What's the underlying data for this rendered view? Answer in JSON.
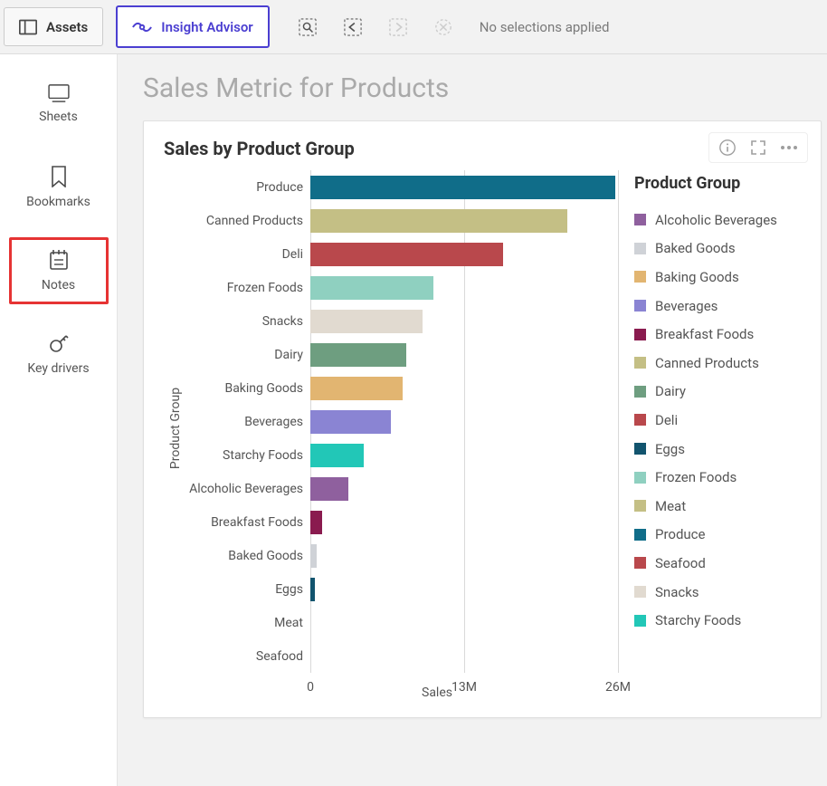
{
  "topbar": {
    "assets_label": "Assets",
    "insight_label": "Insight Advisor",
    "selections_text": "No selections applied"
  },
  "sidebar": {
    "items": [
      {
        "label": "Sheets"
      },
      {
        "label": "Bookmarks"
      },
      {
        "label": "Notes"
      },
      {
        "label": "Key drivers"
      }
    ]
  },
  "page": {
    "title": "Sales Metric for Products"
  },
  "card": {
    "title": "Sales by Product Group"
  },
  "legend": {
    "title": "Product Group",
    "items": [
      {
        "name": "Alcoholic Beverages",
        "color": "#8f609e"
      },
      {
        "name": "Baked Goods",
        "color": "#cfd2d7"
      },
      {
        "name": "Baking Goods",
        "color": "#e2b571"
      },
      {
        "name": "Beverages",
        "color": "#8a84d3"
      },
      {
        "name": "Breakfast Foods",
        "color": "#8a1b4f"
      },
      {
        "name": "Canned Products",
        "color": "#c4bf85"
      },
      {
        "name": "Dairy",
        "color": "#6e9e80"
      },
      {
        "name": "Deli",
        "color": "#b9484c"
      },
      {
        "name": "Eggs",
        "color": "#12546e"
      },
      {
        "name": "Frozen Foods",
        "color": "#8fd0c0"
      },
      {
        "name": "Meat",
        "color": "#c4bf85"
      },
      {
        "name": "Produce",
        "color": "#106d89"
      },
      {
        "name": "Seafood",
        "color": "#b9484c"
      },
      {
        "name": "Snacks",
        "color": "#e1dad0"
      },
      {
        "name": "Starchy Foods",
        "color": "#22c7b7"
      }
    ]
  },
  "chart_data": {
    "type": "bar",
    "orientation": "horizontal",
    "title": "Sales by Product Group",
    "xlabel": "Sales",
    "ylabel": "Product Group",
    "xlim": [
      0,
      26000000
    ],
    "xticks": [
      0,
      13000000,
      26000000
    ],
    "xtick_labels": [
      "0",
      "13M",
      "26M"
    ],
    "series": [
      {
        "name": "Produce",
        "value": 25800000,
        "color": "#106d89"
      },
      {
        "name": "Canned Products",
        "value": 21700000,
        "color": "#c4bf85"
      },
      {
        "name": "Deli",
        "value": 16300000,
        "color": "#b9484c"
      },
      {
        "name": "Frozen Foods",
        "value": 10400000,
        "color": "#8fd0c0"
      },
      {
        "name": "Snacks",
        "value": 9500000,
        "color": "#e1dad0"
      },
      {
        "name": "Dairy",
        "value": 8100000,
        "color": "#6e9e80"
      },
      {
        "name": "Baking Goods",
        "value": 7800000,
        "color": "#e2b571"
      },
      {
        "name": "Beverages",
        "value": 6800000,
        "color": "#8a84d3"
      },
      {
        "name": "Starchy Foods",
        "value": 4500000,
        "color": "#22c7b7"
      },
      {
        "name": "Alcoholic Beverages",
        "value": 3200000,
        "color": "#8f609e"
      },
      {
        "name": "Breakfast Foods",
        "value": 1000000,
        "color": "#8a1b4f"
      },
      {
        "name": "Baked Goods",
        "value": 500000,
        "color": "#cfd2d7"
      },
      {
        "name": "Eggs",
        "value": 400000,
        "color": "#12546e"
      },
      {
        "name": "Meat",
        "value": 0,
        "color": "#c4bf85"
      },
      {
        "name": "Seafood",
        "value": 0,
        "color": "#b9484c"
      }
    ]
  }
}
